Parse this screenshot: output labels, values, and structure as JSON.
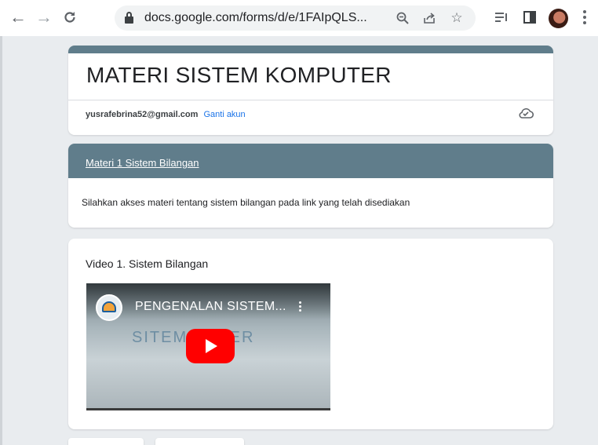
{
  "browser": {
    "url": "docs.google.com/forms/d/e/1FAIpQLS...",
    "icons": [
      "back-arrow-icon",
      "forward-arrow-icon",
      "reload-icon",
      "lock-icon",
      "zoom-icon",
      "share-icon",
      "bookmark-star-icon",
      "reading-list-icon",
      "side-panel-icon",
      "profile-avatar",
      "menu-dots-icon"
    ]
  },
  "form": {
    "title": "MATERI SISTEM KOMPUTER",
    "account_email": "yusrafebrina52@gmail.com",
    "switch_account": "Ganti akun",
    "accent_color": "#607d8b"
  },
  "section": {
    "title": "Materi 1 Sistem Bilangan",
    "description": "Silahkan akses materi tentang sistem bilangan pada link yang telah disediakan"
  },
  "video_item": {
    "title": "Video 1. Sistem Bilangan",
    "video_title": "PENGENALAN SISTEM...",
    "thumbnail_text": "SITEM    PUTER"
  }
}
